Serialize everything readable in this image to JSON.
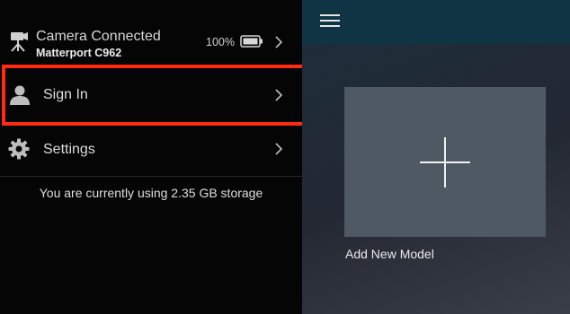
{
  "drawer": {
    "camera": {
      "title": "Camera Connected",
      "model": "Matterport C962",
      "battery_percent_label": "100%",
      "icon": "camera-tripod-icon"
    },
    "sign_in": {
      "label": "Sign In",
      "icon": "user-icon"
    },
    "settings": {
      "label": "Settings",
      "icon": "gear-icon"
    },
    "storage_text": "You are currently using 2.35 GB storage"
  },
  "main": {
    "menu_icon": "hamburger-menu-icon",
    "add_model_label": "Add New Model"
  },
  "colors": {
    "highlight": "#ff2a10",
    "topbar": "#0f3443",
    "tile": "#4f5963"
  }
}
